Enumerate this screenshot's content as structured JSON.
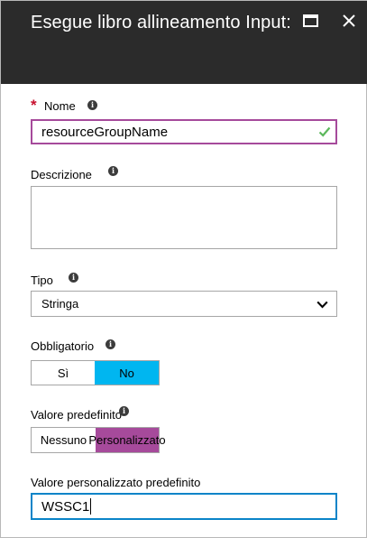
{
  "header": {
    "title": "Esegue libro allineamento Input:",
    "maximize_icon": "maximize-icon",
    "close_icon": "close-icon"
  },
  "colors": {
    "header_bg": "#2b2b2b",
    "required": "#c8102e",
    "valid_border": "#a64a9b",
    "check": "#5cb85c",
    "selected_blue": "#00b6f0",
    "selected_purple": "#a64a9b",
    "focus_border": "#0a84c8"
  },
  "form": {
    "name": {
      "label": "Nome",
      "required_mark": "*",
      "value": "resourceGroupName",
      "valid": true
    },
    "description": {
      "label": "Descrizione",
      "value": ""
    },
    "type": {
      "label": "Tipo",
      "selected": "Stringa"
    },
    "mandatory": {
      "label": "Obbligatorio",
      "options": [
        "Sì",
        "No"
      ],
      "selected": "No"
    },
    "default_value": {
      "label": "Valore predefinito",
      "options": [
        "Nessuno",
        "Personalizzato"
      ],
      "selected": "Personalizzato"
    },
    "custom_default": {
      "label": "Valore personalizzato predefinito",
      "value": "WSSC1"
    }
  }
}
